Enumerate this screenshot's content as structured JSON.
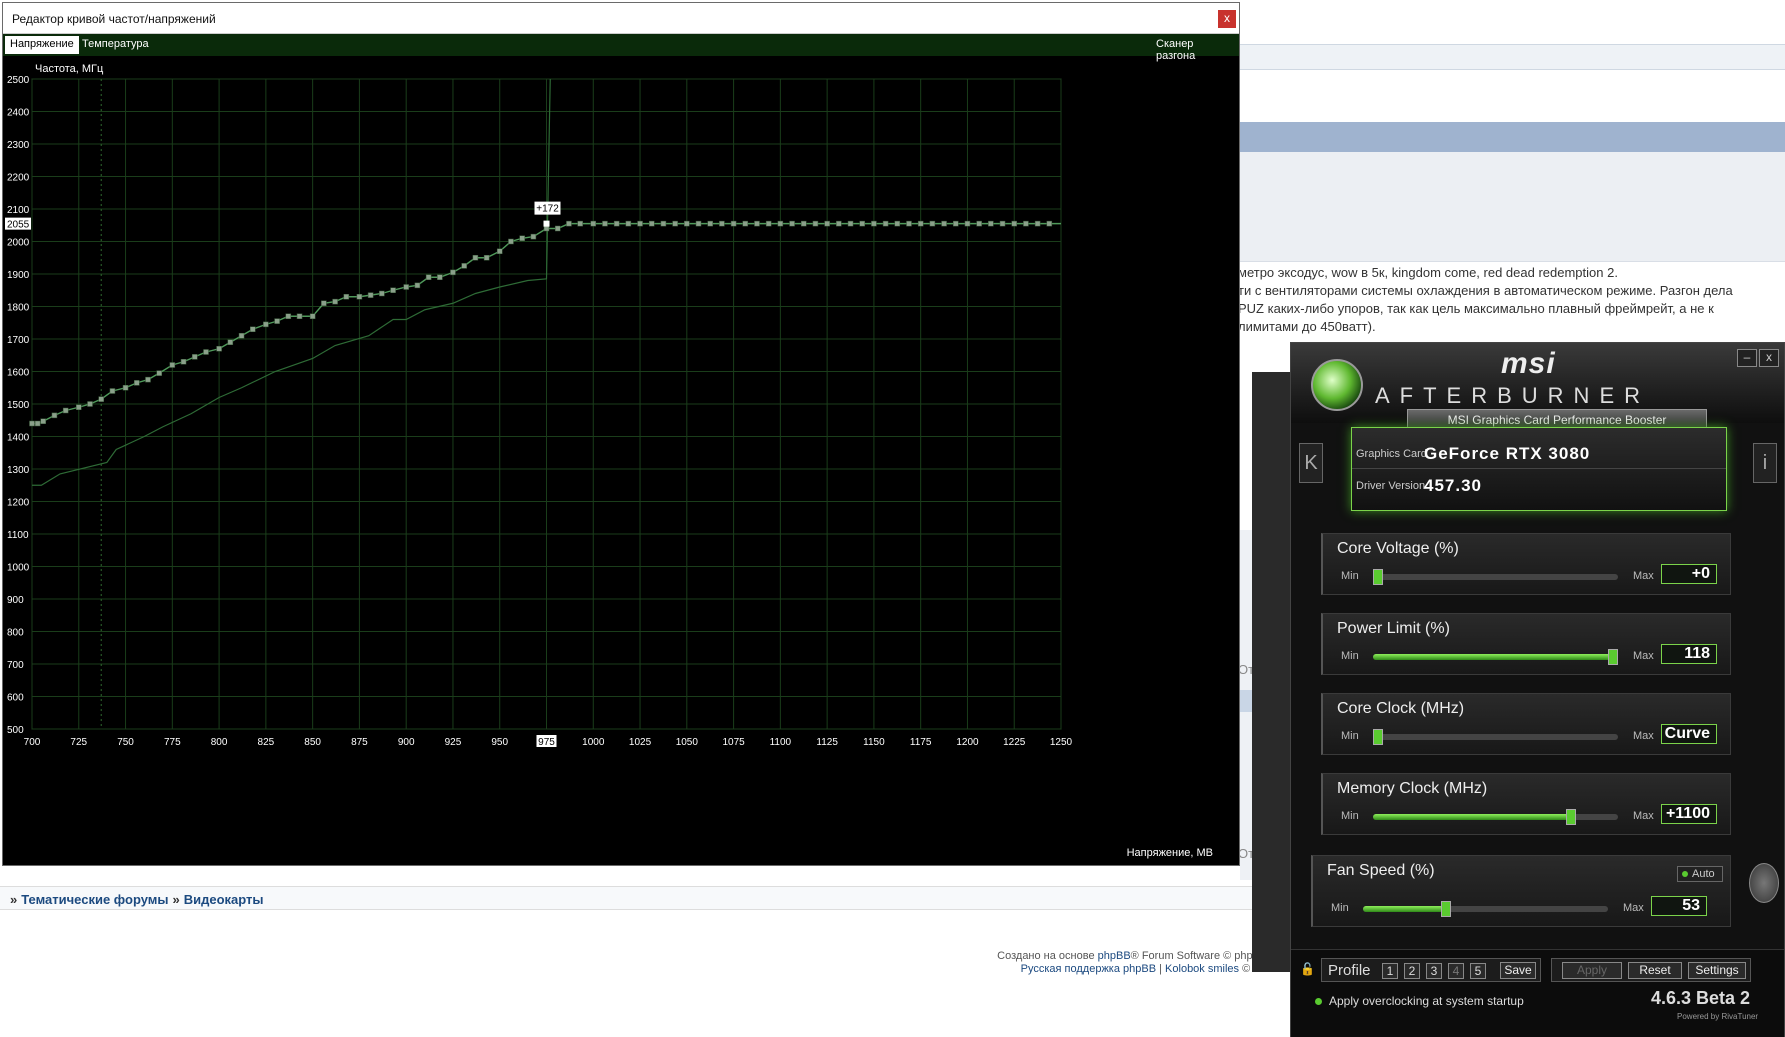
{
  "editor": {
    "title": "Редактор кривой частот/напряжений",
    "close": "x",
    "tabs": [
      "Напряжение",
      "Температура"
    ],
    "scanner": "Сканер разгона",
    "y_axis_label": "Частота, МГц",
    "x_axis_label": "Напряжение, МВ",
    "current_freq": "2055",
    "current_voltage": "975",
    "offset_label": "+172"
  },
  "chart_data": {
    "type": "line",
    "x_ticks": [
      700,
      725,
      750,
      775,
      800,
      825,
      850,
      875,
      900,
      925,
      950,
      975,
      1000,
      1025,
      1050,
      1075,
      1100,
      1125,
      1150,
      1175,
      1200,
      1225,
      1250
    ],
    "y_ticks": [
      500,
      600,
      700,
      800,
      900,
      1000,
      1100,
      1200,
      1300,
      1400,
      1500,
      1600,
      1700,
      1800,
      1900,
      2000,
      2055,
      2100,
      2200,
      2300,
      2400,
      2500
    ],
    "xlim": [
      700,
      1250
    ],
    "ylim": [
      500,
      2500
    ],
    "grid": true,
    "series": [
      {
        "role": "edited-curve",
        "color": "#4f9a5a",
        "markers": true,
        "points": [
          [
            700,
            1440
          ],
          [
            703,
            1440
          ],
          [
            706,
            1447
          ],
          [
            712,
            1465
          ],
          [
            718,
            1480
          ],
          [
            725,
            1490
          ],
          [
            731,
            1500
          ],
          [
            737,
            1515
          ],
          [
            743,
            1540
          ],
          [
            750,
            1550
          ],
          [
            756,
            1565
          ],
          [
            762,
            1575
          ],
          [
            768,
            1595
          ],
          [
            775,
            1620
          ],
          [
            781,
            1630
          ],
          [
            787,
            1645
          ],
          [
            793,
            1660
          ],
          [
            800,
            1670
          ],
          [
            806,
            1690
          ],
          [
            812,
            1710
          ],
          [
            818,
            1730
          ],
          [
            825,
            1745
          ],
          [
            831,
            1755
          ],
          [
            837,
            1770
          ],
          [
            843,
            1770
          ],
          [
            850,
            1770
          ],
          [
            856,
            1810
          ],
          [
            862,
            1815
          ],
          [
            868,
            1830
          ],
          [
            875,
            1830
          ],
          [
            881,
            1835
          ],
          [
            887,
            1840
          ],
          [
            893,
            1850
          ],
          [
            900,
            1860
          ],
          [
            906,
            1865
          ],
          [
            912,
            1890
          ],
          [
            918,
            1890
          ],
          [
            925,
            1905
          ],
          [
            931,
            1925
          ],
          [
            937,
            1950
          ],
          [
            943,
            1950
          ],
          [
            950,
            1970
          ],
          [
            956,
            2000
          ],
          [
            962,
            2010
          ],
          [
            968,
            2015
          ],
          [
            975,
            2040
          ],
          [
            981,
            2040
          ],
          [
            987,
            2055
          ],
          [
            993,
            2055
          ],
          [
            1000,
            2055
          ],
          [
            1250,
            2055
          ]
        ]
      },
      {
        "role": "default-curve",
        "color": "#2e6b36",
        "markers": false,
        "points": [
          [
            700,
            1250
          ],
          [
            705,
            1250
          ],
          [
            715,
            1285
          ],
          [
            740,
            1320
          ],
          [
            745,
            1360
          ],
          [
            760,
            1400
          ],
          [
            770,
            1430
          ],
          [
            785,
            1470
          ],
          [
            800,
            1520
          ],
          [
            812,
            1550
          ],
          [
            830,
            1600
          ],
          [
            850,
            1640
          ],
          [
            862,
            1680
          ],
          [
            880,
            1710
          ],
          [
            893,
            1760
          ],
          [
            900,
            1760
          ],
          [
            910,
            1790
          ],
          [
            925,
            1810
          ],
          [
            937,
            1840
          ],
          [
            950,
            1860
          ],
          [
            965,
            1880
          ],
          [
            975,
            1885
          ],
          [
            977,
            2500
          ]
        ]
      }
    ],
    "selected_point": {
      "x": 975,
      "y": 2055
    }
  },
  "forum": {
    "post_lines": [
      " метро эксодус, wow в 5к, kingdom come, red dead redemption 2.",
      "ти с вентиляторами системы охлаждения в автоматическом режиме. Разгон дела",
      "PUZ  каких-либо упоров, так как цель максимально плавный фреймрейт, а не к",
      "лимитами до 450ватт)."
    ],
    "ot1": "От",
    "ot2": "От",
    "breadcrumb": [
      "Тематические форумы",
      "Видеокарты"
    ],
    "breadcrumb_lead": "»",
    "breadcrumb_sep": "»",
    "footer_line1_prefix": "Создано на основе ",
    "footer_phpbb": "phpBB",
    "footer_line1_suffix": "® Forum Software © phpB",
    "footer_support": "Русская поддержка phpBB",
    "footer_pipe": "|",
    "footer_kolobok": "Kolobok smiles",
    "footer_tail": "© A"
  },
  "afterburner": {
    "brand": "msi",
    "title": "AFTERBURNER",
    "subtitle": "MSI Graphics Card Performance Booster",
    "graphics_card_label": "Graphics Card",
    "graphics_card": "GeForce RTX 3080",
    "driver_label": "Driver Version",
    "driver": "457.30",
    "nav_left": "K",
    "nav_right": "i",
    "min_btn": "–",
    "close_btn": "x",
    "sliders": [
      {
        "title": "Core Voltage (%)",
        "min": "Min",
        "max": "Max",
        "value": "+0",
        "fill": 0.0
      },
      {
        "title": "Power Limit (%)",
        "min": "Min",
        "max": "Max",
        "value": "118",
        "fill": 1.0
      },
      {
        "title": "Core Clock (MHz)",
        "min": "Min",
        "max": "Max",
        "value": "Curve",
        "fill": 0.0
      },
      {
        "title": "Memory Clock (MHz)",
        "min": "Min",
        "max": "Max",
        "value": "+1100",
        "fill": 0.82
      },
      {
        "title": "Fan Speed (%)",
        "min": "Min",
        "max": "Max",
        "value": "53",
        "fill": 0.33
      }
    ],
    "fan_auto": "Auto",
    "profile_label": "Profile",
    "profiles": [
      "1",
      "2",
      "3",
      "4",
      "5"
    ],
    "save": "Save",
    "apply": "Apply",
    "reset": "Reset",
    "settings": "Settings",
    "startup": "Apply overclocking at system startup",
    "version": "4.6.3 Beta 2",
    "powered": "Powered by RivaTuner",
    "accent": "#5acb30"
  }
}
